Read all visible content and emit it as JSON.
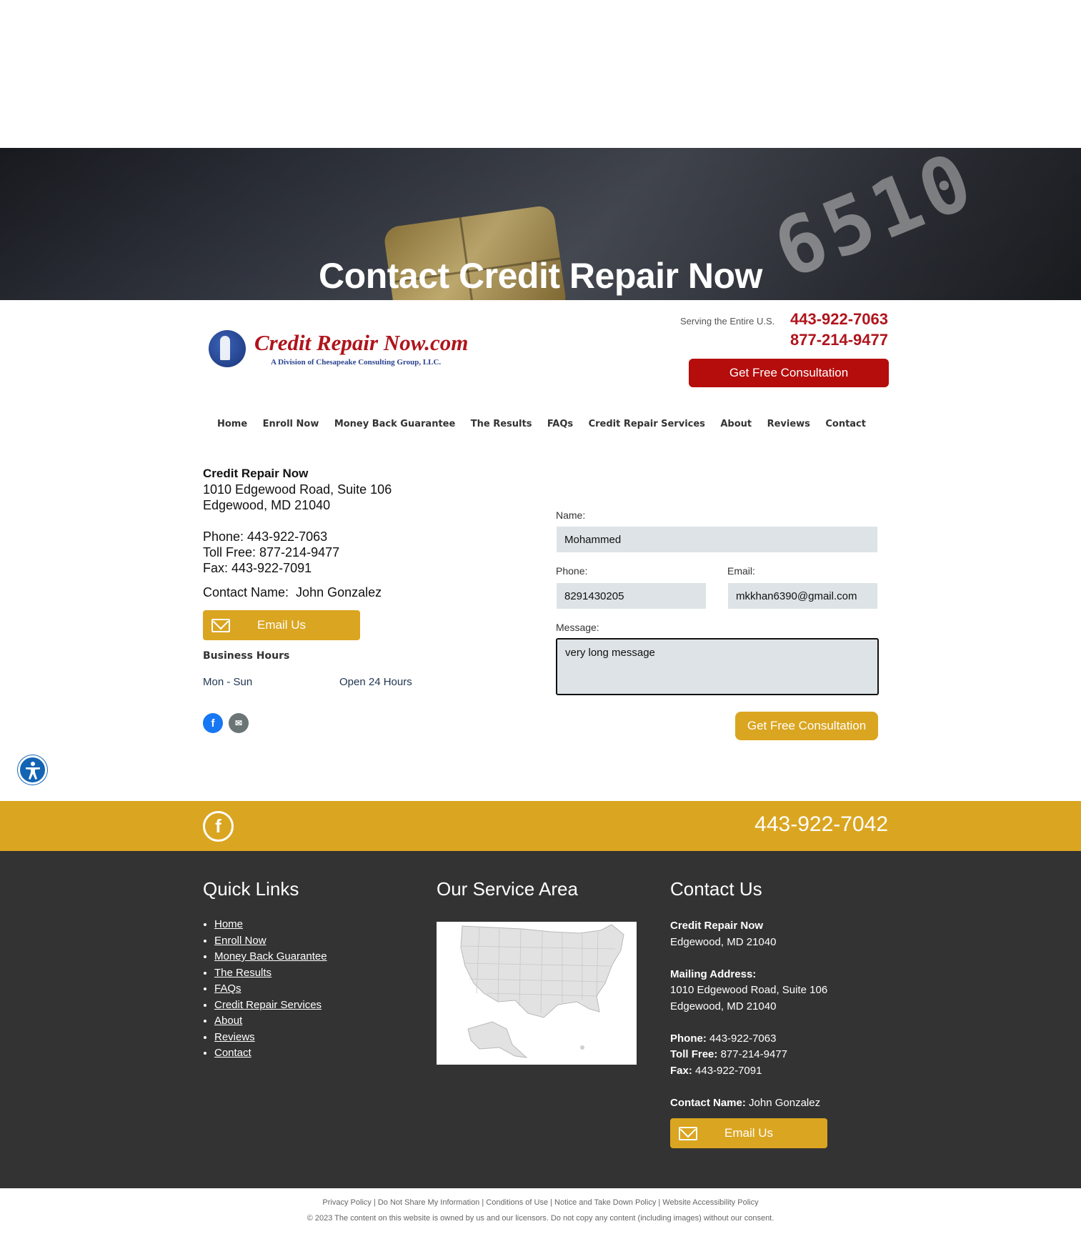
{
  "hero": {
    "title": "Contact Credit Repair Now"
  },
  "header": {
    "logo_name": "Credit Repair Now.com",
    "logo_sub": "A Division of Chesapeake Consulting Group, LLC.",
    "serving": "Serving the Entire U.S.",
    "phone1": "443-922-7063",
    "phone2": "877-214-9477",
    "cta": "Get Free Consultation"
  },
  "nav": [
    "Home",
    "Enroll Now",
    "Money Back Guarantee",
    "The Results",
    "FAQs",
    "Credit Repair Services",
    "About",
    "Reviews",
    "Contact"
  ],
  "info": {
    "company": "Credit Repair Now",
    "address1": "1010 Edgewood Road, Suite 106",
    "address2": "Edgewood, MD 21040",
    "phone": "Phone: 443-922-7063",
    "tollfree": "Toll Free: 877-214-9477",
    "fax": "Fax: 443-922-7091",
    "contact_name": "Contact Name:  John Gonzalez",
    "email_btn": "Email Us",
    "hours_title": "Business Hours",
    "hours_day": "Mon - Sun",
    "hours_value": "Open 24 Hours"
  },
  "form": {
    "name_label": "Name:",
    "name_value": "Mohammed",
    "phone_label": "Phone:",
    "phone_value": "8291430205",
    "email_label": "Email:",
    "email_value": "mkkhan6390@gmail.com",
    "message_label": "Message:",
    "message_value": "very long message",
    "submit": "Get Free Consultation"
  },
  "goldbar": {
    "phone": "443-922-7042"
  },
  "footer": {
    "quick_links_title": "Quick Links",
    "quick_links": [
      "Home",
      "Enroll Now",
      "Money Back Guarantee",
      "The Results",
      "FAQs",
      "Credit Repair Services",
      "About",
      "Reviews",
      "Contact"
    ],
    "service_area_title": "Our Service Area",
    "contact_title": "Contact Us",
    "contact": {
      "company": "Credit Repair Now",
      "city": "Edgewood, MD 21040",
      "mailing_label": "Mailing Address:",
      "address1": "1010 Edgewood Road, Suite 106",
      "address2": "Edgewood, MD 21040",
      "phone_label": "Phone:",
      "phone": "443-922-7063",
      "tollfree_label": "Toll Free:",
      "tollfree": "877-214-9477",
      "fax_label": "Fax:",
      "fax": "443-922-7091",
      "contact_name_label": "Contact Name:",
      "contact_name": "John Gonzalez",
      "email_btn": "Email Us"
    }
  },
  "legal": {
    "links": "Privacy Policy | Do Not Share My Information | Conditions of Use | Notice and Take Down Policy | Website Accessibility Policy",
    "copyright": "© 2023 The content on this website is owned by us and our licensors. Do not copy any content (including images) without our consent."
  },
  "colors": {
    "brand_red": "#b50c0c",
    "gold": "#daa520",
    "footer_bg": "#333333",
    "field_bg": "#dde3e6"
  },
  "icons": [
    "envelope-icon",
    "facebook-icon",
    "mail-icon",
    "accessibility-icon",
    "us-map"
  ]
}
